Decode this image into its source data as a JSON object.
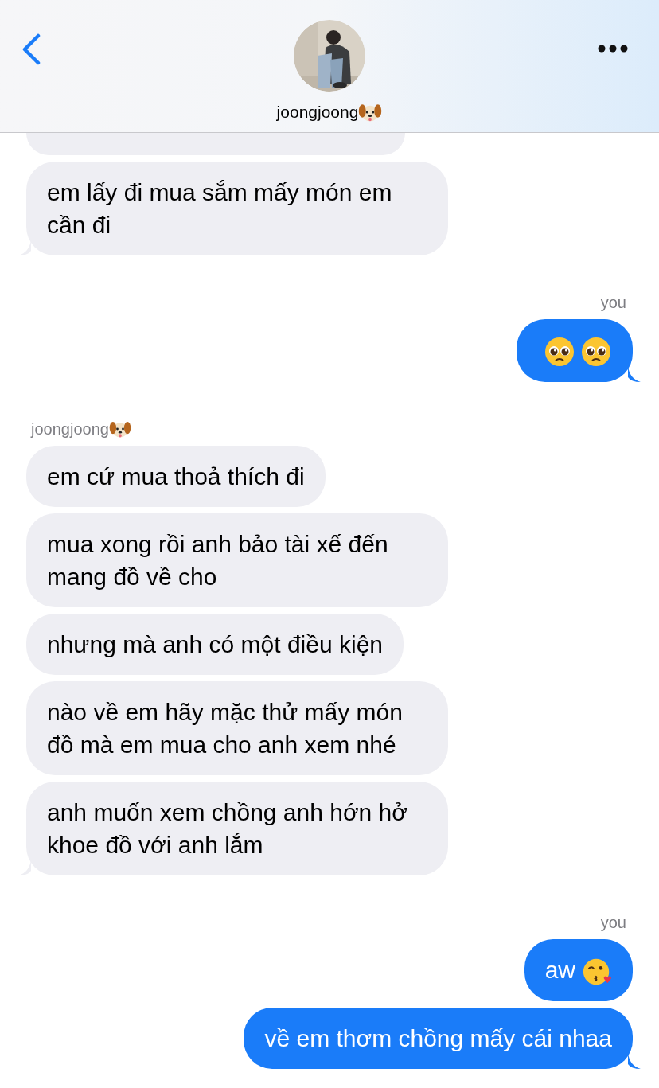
{
  "header": {
    "contact_name": "joongjoong",
    "contact_emoji": {
      "kind": "dog"
    }
  },
  "groups": [
    {
      "kind": "incoming",
      "messages": [
        {
          "kind": "hidden"
        },
        {
          "kind": "text",
          "text": "em lấy đi mua sắm mấy món em cần đi"
        }
      ]
    },
    {
      "kind": "outgoing",
      "label": {
        "text": "you"
      },
      "messages": [
        {
          "kind": "emoji",
          "emoji": [
            {
              "kind": "pleading"
            },
            {
              "kind": "pleading"
            }
          ]
        }
      ]
    },
    {
      "kind": "incoming",
      "label": {
        "text": "joongjoong",
        "emoji": {
          "kind": "dog"
        }
      },
      "messages": [
        {
          "kind": "text",
          "text": "em cứ mua thoả thích đi"
        },
        {
          "kind": "text",
          "text": "mua xong rồi anh bảo tài xế đến mang đồ về cho"
        },
        {
          "kind": "text",
          "text": "nhưng mà anh có một điều kiện"
        },
        {
          "kind": "text",
          "text": "nào về em hãy mặc thử mấy món đồ mà em mua cho anh xem nhé"
        },
        {
          "kind": "text",
          "text": "anh muốn xem chồng anh hớn hở khoe đồ với anh lắm"
        }
      ]
    },
    {
      "kind": "outgoing",
      "label": {
        "text": "you"
      },
      "messages": [
        {
          "kind": "text",
          "text": "aw",
          "emoji": [
            {
              "kind": "kiss"
            }
          ]
        },
        {
          "kind": "text",
          "text": "về em thơm chồng mấy cái nhaa"
        }
      ]
    }
  ]
}
